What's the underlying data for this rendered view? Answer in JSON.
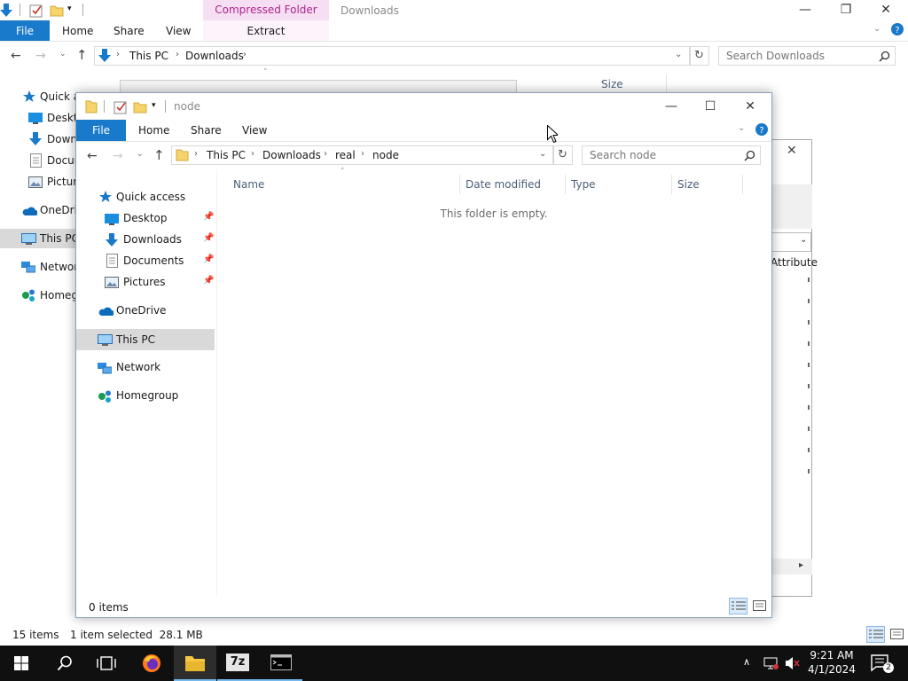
{
  "background_window": {
    "ribbon_context": "Compressed Folder Tools",
    "title": "Downloads",
    "tabs": [
      "File",
      "Home",
      "Share",
      "View"
    ],
    "context_tab": "Extract",
    "breadcrumb": [
      "This PC",
      "Downloads"
    ],
    "search_placeholder": "Search Downloads",
    "column_size": "Size",
    "nav": {
      "quick_access": "Quick a",
      "desktop": "Deskto",
      "downloads": "Down",
      "documents": "Docum",
      "pictures": "Pictur",
      "onedrive": "OneDriv",
      "this_pc": "This PC",
      "network": "Network",
      "homegroup": "Homeg"
    },
    "status_items": "15 items",
    "status_selected": "1 item selected  28.1 MB"
  },
  "middle_dialog": {
    "column_attributes": "Attribute"
  },
  "front_window": {
    "title": "node",
    "tabs": [
      "File",
      "Home",
      "Share",
      "View"
    ],
    "breadcrumb": [
      "This PC",
      "Downloads",
      "real",
      "node"
    ],
    "search_placeholder": "Search node",
    "columns": [
      "Name",
      "Date modified",
      "Type",
      "Size"
    ],
    "empty_message": "This folder is empty.",
    "nav": {
      "quick_access": "Quick access",
      "desktop": "Desktop",
      "downloads": "Downloads",
      "documents": "Documents",
      "pictures": "Pictures",
      "onedrive": "OneDrive",
      "this_pc": "This PC",
      "network": "Network",
      "homegroup": "Homegroup"
    },
    "status": "0 items"
  },
  "taskbar": {
    "time": "9:21 AM",
    "date": "4/1/2024",
    "notification_count": "2",
    "sevenzip_label": "7z"
  },
  "colors": {
    "accent": "#1979ca",
    "context_tab_bg": "#f6dff2",
    "context_tab_text": "#b0238f",
    "taskbar": "#101010"
  }
}
